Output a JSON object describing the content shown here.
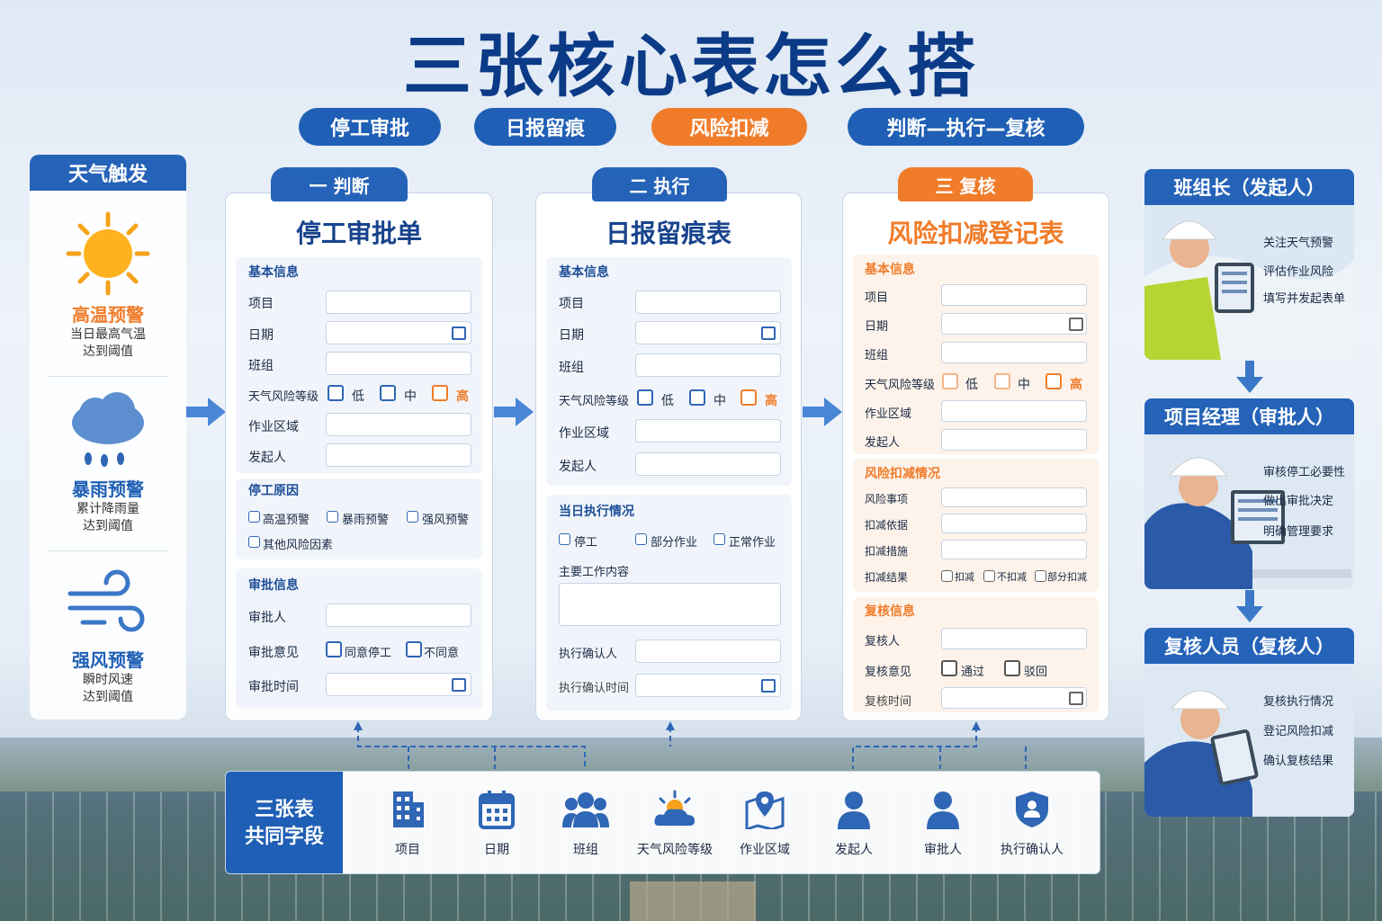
{
  "title": "三张核心表怎么搭",
  "pills": [
    "停工审批",
    "日报留痕",
    "风险扣减",
    "判断—执行—复核"
  ],
  "weather": {
    "header": "天气触发",
    "items": [
      {
        "name": "高温预警",
        "desc1": "当日最高气温",
        "desc2": "达到阈值"
      },
      {
        "name": "暴雨预警",
        "desc1": "累计降雨量",
        "desc2": "达到阈值"
      },
      {
        "name": "强风预警",
        "desc1": "瞬时风速",
        "desc2": "达到阈值"
      }
    ]
  },
  "card1": {
    "tab": "一 判断",
    "title": "停工审批单",
    "basic_header": "基本信息",
    "fields": [
      "项目",
      "日期",
      "班组",
      "天气风险等级",
      "作业区域",
      "发起人"
    ],
    "levels": [
      "低",
      "中",
      "高"
    ],
    "reason_header": "停工原因",
    "reasons": [
      "高温预警",
      "暴雨预警",
      "强风预警",
      "其他风险因素"
    ],
    "approval_header": "审批信息",
    "approver": "审批人",
    "opinion": "审批意见",
    "opinions": [
      "同意停工",
      "不同意"
    ],
    "time": "审批时间"
  },
  "card2": {
    "tab": "二 执行",
    "title": "日报留痕表",
    "basic_header": "基本信息",
    "fields": [
      "项目",
      "日期",
      "班组",
      "天气风险等级",
      "作业区域",
      "发起人"
    ],
    "levels": [
      "低",
      "中",
      "高"
    ],
    "exec_header": "当日执行情况",
    "status": [
      "停工",
      "部分作业",
      "正常作业"
    ],
    "content": "主要工作内容",
    "confirmer": "执行确认人",
    "confirm_time": "执行确认时间"
  },
  "card3": {
    "tab": "三 复核",
    "title": "风险扣减登记表",
    "basic_header": "基本信息",
    "fields": [
      "项目",
      "日期",
      "班组",
      "天气风险等级",
      "作业区域",
      "发起人"
    ],
    "levels": [
      "低",
      "中",
      "高"
    ],
    "deduct_header": "风险扣减情况",
    "deduct_fields": [
      "风险事项",
      "扣减依据",
      "扣减措施",
      "扣减结果"
    ],
    "results": [
      "扣减",
      "不扣减",
      "部分扣减"
    ],
    "review_header": "复核信息",
    "reviewer": "复核人",
    "review_opinion": "复核意见",
    "review_opts": [
      "通过",
      "驳回"
    ],
    "review_time": "复核时间"
  },
  "roles": [
    {
      "header": "班组长（发起人）",
      "tasks": [
        "关注天气预警",
        "评估作业风险",
        "填写并发起表单"
      ]
    },
    {
      "header": "项目经理（审批人）",
      "tasks": [
        "审核停工必要性",
        "做出审批决定",
        "明确管理要求"
      ]
    },
    {
      "header": "复核人员（复核人）",
      "tasks": [
        "复核执行情况",
        "登记风险扣减",
        "确认复核结果"
      ]
    }
  ],
  "shared": {
    "header1": "三张表",
    "header2": "共同字段",
    "fields": [
      {
        "label": "项目",
        "icon": "building-icon"
      },
      {
        "label": "日期",
        "icon": "calendar-icon"
      },
      {
        "label": "班组",
        "icon": "team-icon"
      },
      {
        "label": "天气风险等级",
        "icon": "weather-icon"
      },
      {
        "label": "作业区域",
        "icon": "map-icon"
      },
      {
        "label": "发起人",
        "icon": "person-icon"
      },
      {
        "label": "审批人",
        "icon": "person-icon"
      },
      {
        "label": "执行确认人",
        "icon": "shield-user-icon"
      }
    ]
  },
  "colors": {
    "primary": "#1f5fb5",
    "accent": "#f07c2a",
    "title": "#0b3a86"
  }
}
